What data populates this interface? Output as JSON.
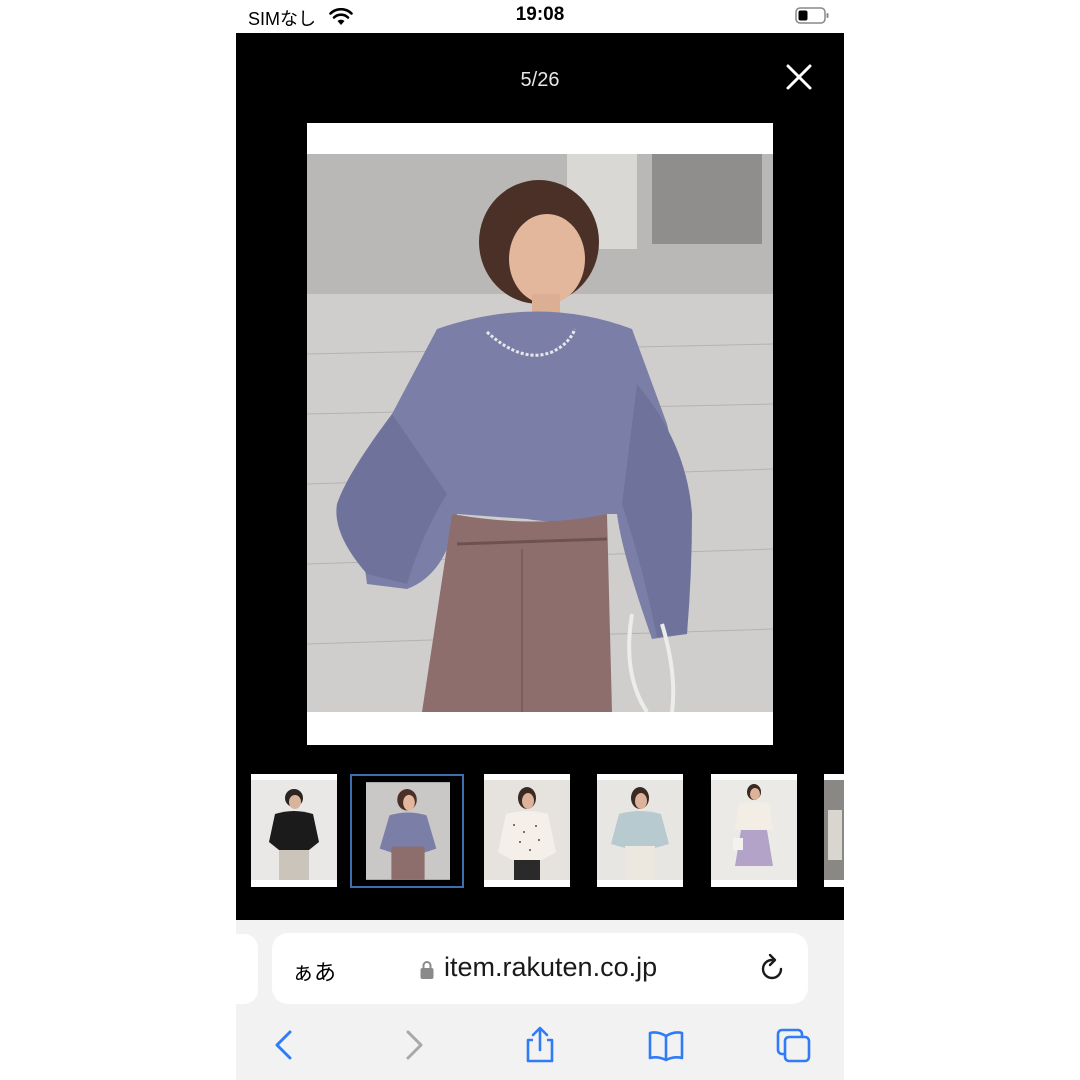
{
  "status_bar": {
    "carrier": "SIMなし",
    "time": "19:08",
    "icons": [
      "wifi-icon",
      "battery-icon"
    ]
  },
  "viewer": {
    "counter": "5/26",
    "close_icon": "close-icon",
    "thumbnails": [
      {
        "name": "black-blouse"
      },
      {
        "name": "purple-blouse",
        "selected": true
      },
      {
        "name": "polka-dot-blouse"
      },
      {
        "name": "light-blue-blouse"
      },
      {
        "name": "cream-blouse-lavender-skirt"
      },
      {
        "name": "grey-blouse-partial"
      }
    ]
  },
  "browser": {
    "aa_label": "ぁあ",
    "url": "item.rakuten.co.jp",
    "toolbar_icons": [
      "back-icon",
      "forward-icon",
      "share-icon",
      "bookmarks-icon",
      "tabs-icon"
    ],
    "accent_color": "#2f7cf6"
  }
}
